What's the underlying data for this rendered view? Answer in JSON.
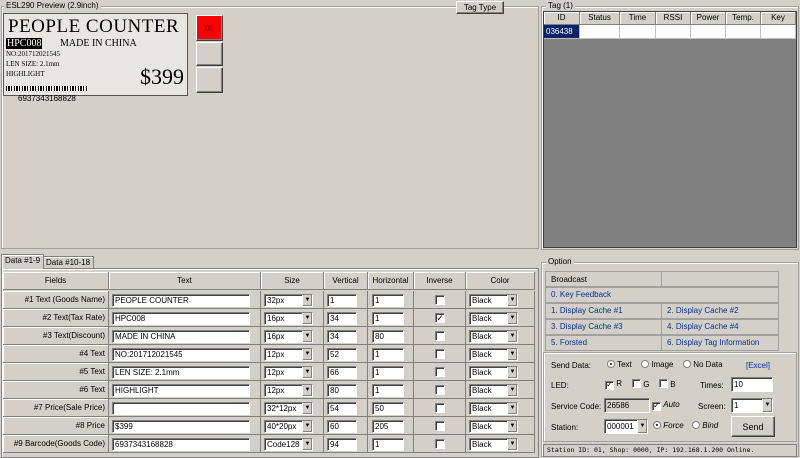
{
  "preview": {
    "title": "ESL290 Preview (2.9inch)",
    "tag_type_label": "Tag Type",
    "red_button_label": "00",
    "label": {
      "goods_name": "PEOPLE COUNTER",
      "tax_rate": "HPC008",
      "discount": "MADE IN CHINA",
      "no": "NO:201712021545",
      "len_size": "LEN SIZE: 2.1mm",
      "highlight": "HIGHLIGHT",
      "price": "$399",
      "barcode": "6937343168828"
    }
  },
  "tag": {
    "title": "Tag (1)",
    "columns": [
      "ID",
      "Status",
      "Time",
      "RSSI",
      "Power",
      "Temp.",
      "Key"
    ],
    "rows": [
      [
        "036438",
        "",
        "",
        "",
        "",
        "",
        ""
      ]
    ]
  },
  "tabs": [
    "Data #1-9",
    "Data #10-18"
  ],
  "grid": {
    "columns": [
      "Fields",
      "Text",
      "Size",
      "Vertical",
      "Horizontal",
      "Inverse",
      "Color"
    ],
    "rows": [
      {
        "field": "#1 Text (Goods Name)",
        "text": "PEOPLE COUNTER",
        "size": "32px",
        "vertical": "1",
        "horizontal": "1",
        "inverse": "",
        "color": "Black"
      },
      {
        "field": "#2 Text(Tax Rate)",
        "text": "HPC008",
        "size": "16px",
        "vertical": "34",
        "horizontal": "1",
        "inverse": "✓",
        "color": "Black"
      },
      {
        "field": "#3 Text(Discount)",
        "text": "MADE IN CHINA",
        "size": "16px",
        "vertical": "34",
        "horizontal": "80",
        "inverse": "",
        "color": "Black"
      },
      {
        "field": "#4 Text",
        "text": "NO:201712021545",
        "size": "12px",
        "vertical": "52",
        "horizontal": "1",
        "inverse": "",
        "color": "Black"
      },
      {
        "field": "#5 Text",
        "text": "LEN SIZE: 2.1mm",
        "size": "12px",
        "vertical": "66",
        "horizontal": "1",
        "inverse": "",
        "color": "Black"
      },
      {
        "field": "#6 Text",
        "text": "HIGHLIGHT",
        "size": "12px",
        "vertical": "80",
        "horizontal": "1",
        "inverse": "",
        "color": "Black"
      },
      {
        "field": "#7 Price(Sale Price)",
        "text": "",
        "size": "32*12px",
        "vertical": "54",
        "horizontal": "50",
        "inverse": "",
        "color": "Black"
      },
      {
        "field": "#8 Price",
        "text": "$399",
        "size": "40*20px",
        "vertical": "60",
        "horizontal": "205",
        "inverse": "",
        "color": "Black"
      },
      {
        "field": "#9 Barcode(Goods Code)",
        "text": "6937343168828",
        "size": "Code128",
        "vertical": "94",
        "horizontal": "1",
        "inverse": "",
        "color": "Black"
      }
    ]
  },
  "option": {
    "title": "Option",
    "broadcast": "Broadcast",
    "items": [
      "0. Key Feedback",
      "1. Display Cache #1",
      "2. Display Cache #2",
      "3. Display Cache #3",
      "4. Display Cache #4",
      "5. Forsted",
      "6. Display Tag Information"
    ],
    "send_data_label": "Send Data:",
    "send_options": [
      "Text",
      "Image",
      "No Data"
    ],
    "excel_label": "[Excel]",
    "led_label": "LED:",
    "led_options": [
      "R",
      "G",
      "B"
    ],
    "times_label": "Times:",
    "times_value": "10",
    "service_code_label": "Service Code:",
    "service_code_value": "26586",
    "auto_label": "Auto",
    "screen_label": "Screen:",
    "screen_value": "1",
    "station_label": "Station:",
    "station_value": "000001",
    "force_label": "Force",
    "bind_label": "Bind",
    "send_button": "Send",
    "status": "Station ID: 01, Shop: 0000, IP: 192.168.1.200 Online."
  },
  "colors": {
    "red_button": "#ff0000",
    "selection": "#0a246a",
    "link": "#003399"
  }
}
